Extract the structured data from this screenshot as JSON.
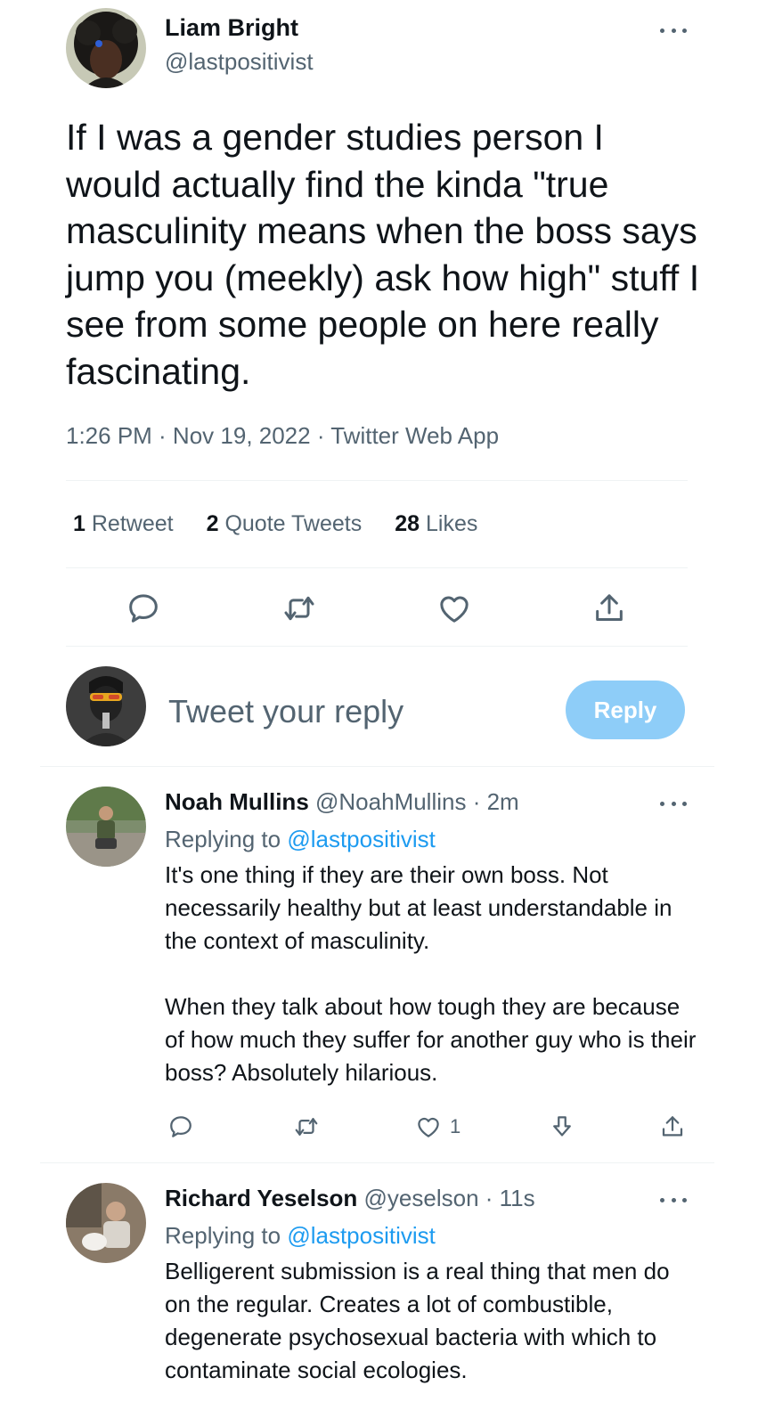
{
  "main_tweet": {
    "author_name": "Liam Bright",
    "handle": "@lastpositivist",
    "text": "If I was a gender studies person I would actually find the kinda \"true masculinity means when the boss says jump you (meekly) ask how high\" stuff I see from some people on here really fascinating.",
    "meta": "1:26 PM · Nov 19, 2022 · Twitter Web App",
    "stats": {
      "retweets_count": "1",
      "retweets_label": "Retweet",
      "quotes_count": "2",
      "quotes_label": "Quote Tweets",
      "likes_count": "28",
      "likes_label": "Likes"
    },
    "actions": [
      "reply-icon",
      "retweet-icon",
      "like-icon",
      "share-icon"
    ]
  },
  "compose": {
    "placeholder": "Tweet your reply",
    "reply_button": "Reply"
  },
  "replies": [
    {
      "author_name": "Noah Mullins",
      "handle_time": "@NoahMullins · 2m",
      "replying_prefix": "Replying to",
      "replying_to": "@lastpositivist",
      "paragraphs": [
        "It's one thing if they are their own boss. Not necessarily healthy but at least understandable in the context of masculinity.",
        "When they talk about how tough they are because of how much they suffer for another guy who is their boss? Absolutely hilarious."
      ],
      "like_count": "1"
    },
    {
      "author_name": "Richard Yeselson",
      "handle_time": "@yeselson · 11s",
      "replying_prefix": "Replying to",
      "replying_to": "@lastpositivist",
      "paragraphs": [
        "Belligerent submission is a real thing that men do on the regular. Creates a lot of combustible, degenerate psychosexual bacteria with which to contaminate social ecologies."
      ]
    }
  ],
  "colors": {
    "text": "#0f1419",
    "secondary": "#536471",
    "link": "#1d9bf0",
    "reply_button_disabled": "#8ecdf8",
    "divider": "#eff3f4"
  }
}
